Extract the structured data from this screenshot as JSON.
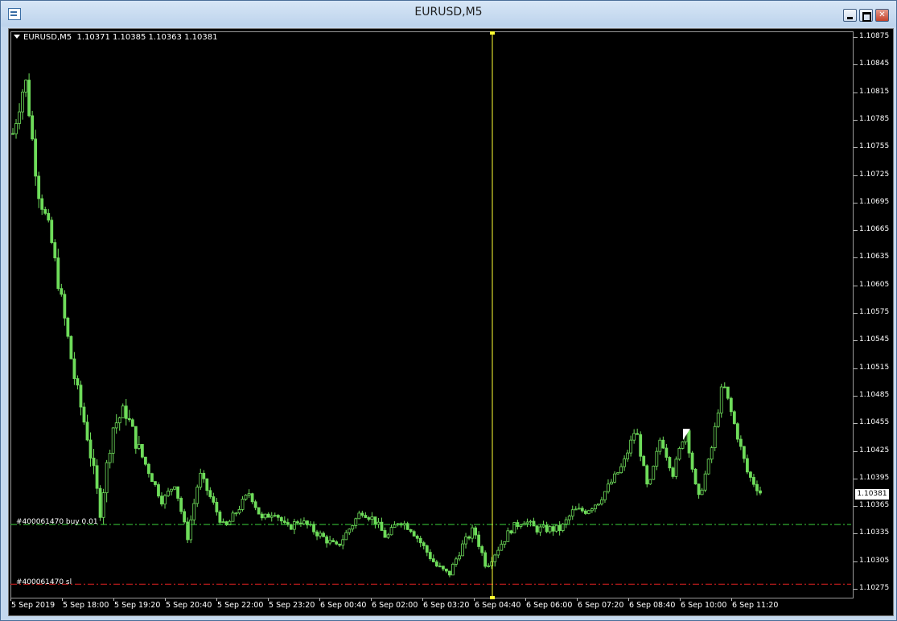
{
  "window": {
    "title": "EURUSD,M5"
  },
  "chart": {
    "symbol_label": "EURUSD,M5",
    "ohlc_label": "1.10371 1.10385 1.10363 1.10381",
    "current_price": "1.10381",
    "colors": {
      "background": "#000000",
      "candle": "#6edc5a",
      "crosshair": "#ffff33",
      "order_line": "#3cd33c",
      "sl_line": "#e02020"
    },
    "order_line": {
      "label": "#400061470 buy 0.01",
      "price": 1.10345
    },
    "sl_line": {
      "label": "#400061470 sl",
      "price": 1.1028
    }
  },
  "chart_data": {
    "type": "candlestick",
    "title": "",
    "ylim": [
      1.1027,
      1.1089
    ],
    "y_ticks": [
      "1.10875",
      "1.10845",
      "1.10815",
      "1.10785",
      "1.10755",
      "1.10725",
      "1.10695",
      "1.10665",
      "1.10635",
      "1.10605",
      "1.10575",
      "1.10545",
      "1.10515",
      "1.10485",
      "1.10455",
      "1.10425",
      "1.10395",
      "1.10365",
      "1.10335",
      "1.10305",
      "1.10275"
    ],
    "x_ticks": [
      "5 Sep 2019",
      "5 Sep 18:00",
      "5 Sep 19:20",
      "5 Sep 20:40",
      "5 Sep 22:00",
      "5 Sep 23:20",
      "6 Sep 00:40",
      "6 Sep 02:00",
      "6 Sep 03:20",
      "6 Sep 04:40",
      "6 Sep 06:00",
      "6 Sep 07:20",
      "6 Sep 08:40",
      "6 Sep 10:00",
      "6 Sep 11:20"
    ],
    "close_path": [
      1.1077,
      1.1083,
      1.1071,
      1.1066,
      1.1058,
      1.105,
      1.1044,
      1.1036,
      1.1045,
      1.1047,
      1.1043,
      1.104,
      1.1037,
      1.1039,
      1.1033,
      1.104,
      1.1037,
      1.1034,
      1.1036,
      1.1038,
      1.1035,
      1.1036,
      1.1034,
      1.1035,
      1.1034,
      1.1033,
      1.1032,
      1.1034,
      1.1036,
      1.1035,
      1.1033,
      1.1035,
      1.1034,
      1.1032,
      1.103,
      1.1029,
      1.1032,
      1.1034,
      1.103,
      1.1032,
      1.1034,
      1.1035,
      1.1034,
      1.1034,
      1.1034,
      1.1036,
      1.1036,
      1.1037,
      1.1039,
      1.1041,
      1.1045,
      1.1038,
      1.1044,
      1.104,
      1.1045,
      1.1037,
      1.1042,
      1.105,
      1.1045,
      1.104,
      1.1038
    ]
  }
}
